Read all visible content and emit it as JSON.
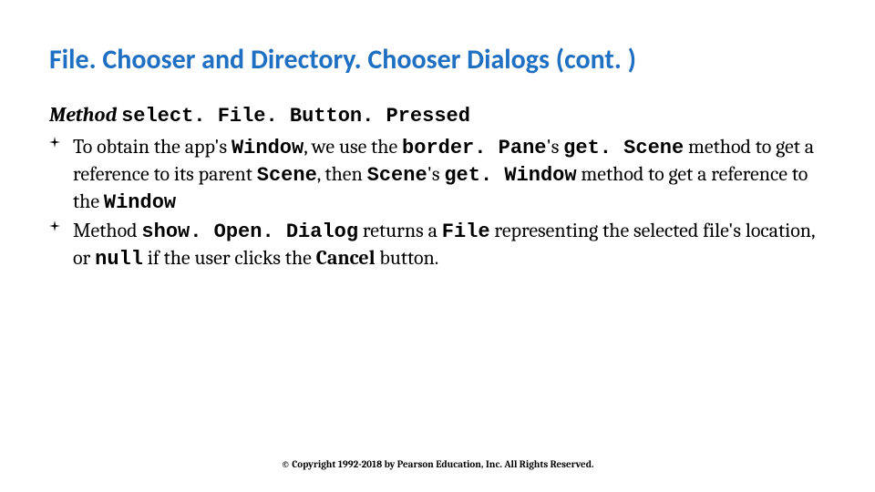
{
  "title": "File. Chooser and Directory. Chooser Dialogs (cont. )",
  "subheading_prefix": "Method ",
  "subheading_method": "select. File. Button. Pressed",
  "bullets": [
    {
      "parts": [
        {
          "t": "To obtain the app's ",
          "cls": ""
        },
        {
          "t": "Window",
          "cls": "mono"
        },
        {
          "t": ", we use the ",
          "cls": ""
        },
        {
          "t": "border. Pane",
          "cls": "mono"
        },
        {
          "t": "'s ",
          "cls": ""
        },
        {
          "t": "get. Scene",
          "cls": "mono"
        },
        {
          "t": " method to get a reference to its parent ",
          "cls": ""
        },
        {
          "t": "Scene",
          "cls": "mono"
        },
        {
          "t": ", then ",
          "cls": ""
        },
        {
          "t": "Scene",
          "cls": "mono"
        },
        {
          "t": "'s ",
          "cls": ""
        },
        {
          "t": "get. Window",
          "cls": "mono"
        },
        {
          "t": " method to get a reference to the ",
          "cls": ""
        },
        {
          "t": "Window",
          "cls": "mono"
        }
      ]
    },
    {
      "parts": [
        {
          "t": "Method ",
          "cls": ""
        },
        {
          "t": "show. Open. Dialog",
          "cls": "mono"
        },
        {
          "t": " returns a ",
          "cls": ""
        },
        {
          "t": "File",
          "cls": "mono"
        },
        {
          "t": " representing the selected file's location, or ",
          "cls": ""
        },
        {
          "t": "null",
          "cls": "mono"
        },
        {
          "t": " if the user clicks the ",
          "cls": ""
        },
        {
          "t": "Cancel",
          "cls": "bold"
        },
        {
          "t": " button.",
          "cls": ""
        }
      ]
    }
  ],
  "footer": "© Copyright 1992-2018 by Pearson Education, Inc. All Rights Reserved."
}
